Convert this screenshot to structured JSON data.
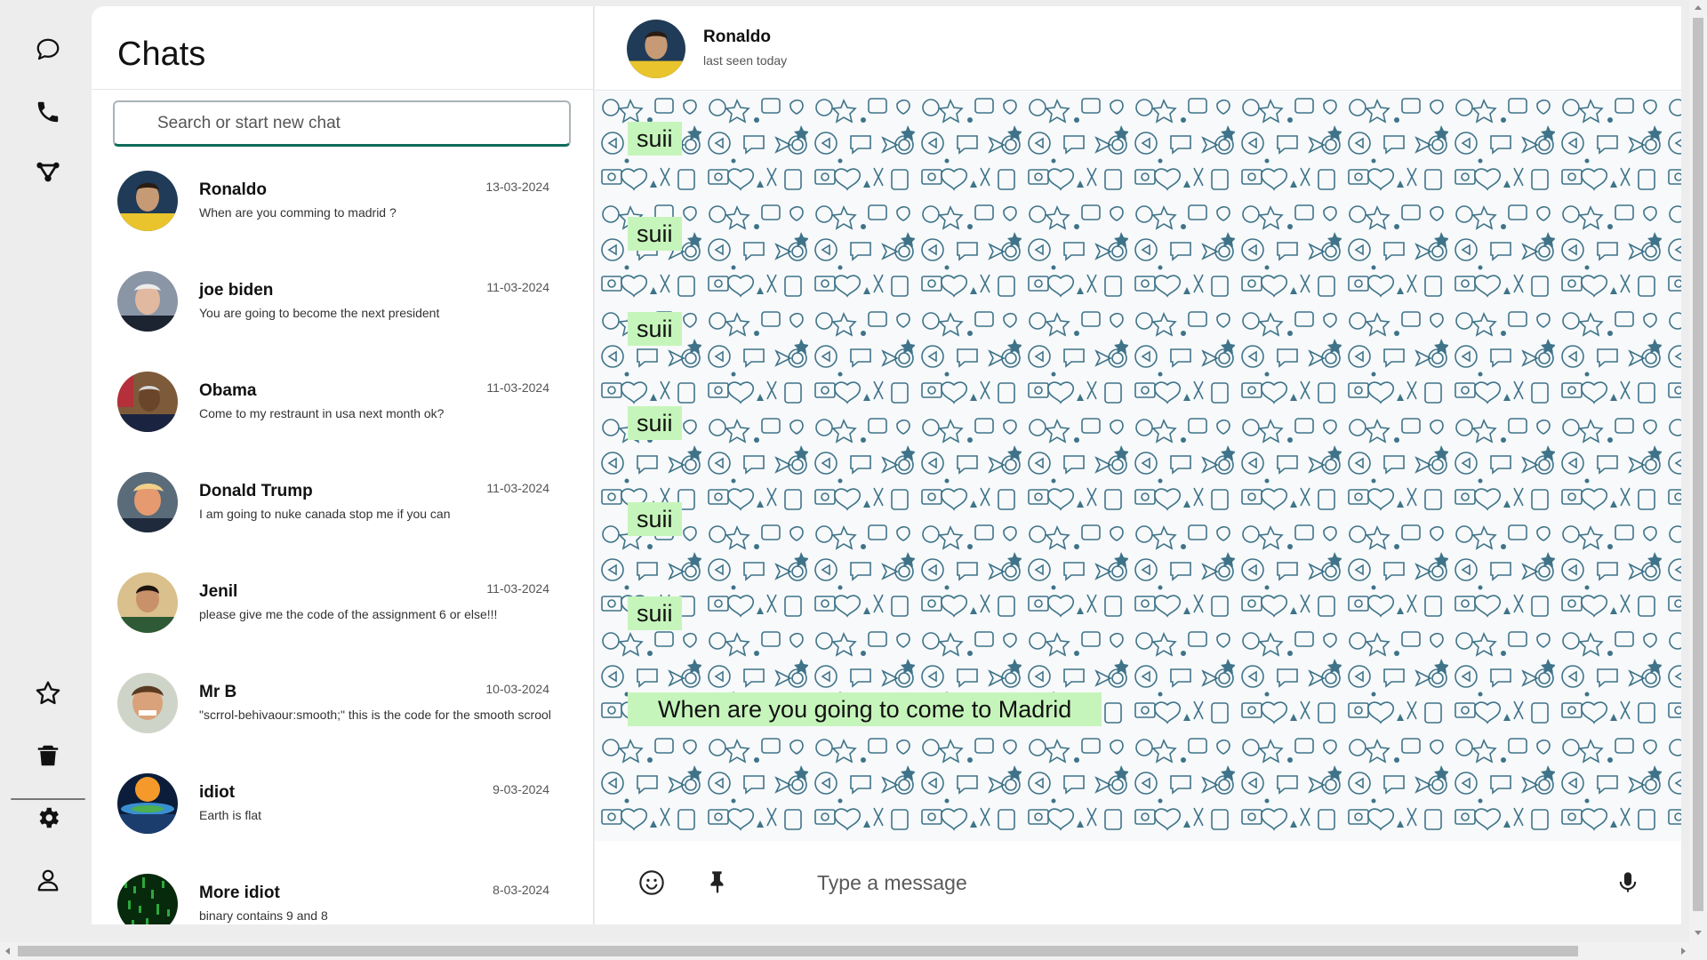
{
  "sidebar": {
    "icons": [
      "chat-icon",
      "phone-icon",
      "share-icon",
      "star-icon",
      "trash-icon",
      "gear-icon",
      "user-icon"
    ]
  },
  "chats": {
    "title": "Chats",
    "search_placeholder": "Search or start new chat",
    "items": [
      {
        "name": "Ronaldo",
        "message": "When are you comming to madrid ?",
        "date": "13-03-2024"
      },
      {
        "name": "joe biden",
        "message": "You are going to become the next president",
        "date": "11-03-2024"
      },
      {
        "name": "Obama",
        "message": "Come to my restraunt in usa next month ok?",
        "date": "11-03-2024"
      },
      {
        "name": "Donald Trump",
        "message": "I am going to nuke canada stop me if you can",
        "date": "11-03-2024"
      },
      {
        "name": "Jenil",
        "message": "please give me the code of the assignment 6 or else!!!",
        "date": "11-03-2024"
      },
      {
        "name": "Mr B",
        "message": "\"scrrol-behivaour:smooth;\" this is the code for the smooth scrool",
        "date": "10-03-2024"
      },
      {
        "name": "idiot",
        "message": "Earth is flat",
        "date": "9-03-2024"
      },
      {
        "name": "More idiot",
        "message": "binary contains 9 and 8",
        "date": "8-03-2024"
      }
    ]
  },
  "conversation": {
    "contact_name": "Ronaldo",
    "status": "last seen today",
    "messages": [
      "suii",
      "suii",
      "suii",
      "suii",
      "suii",
      "suii",
      "When are you going to come to Madrid"
    ]
  },
  "composer": {
    "placeholder": "Type a message"
  },
  "colors": {
    "accent": "#0e6b5a",
    "bubble": "#c6f5bb",
    "wallpaper_doodle": "#3f7389"
  }
}
